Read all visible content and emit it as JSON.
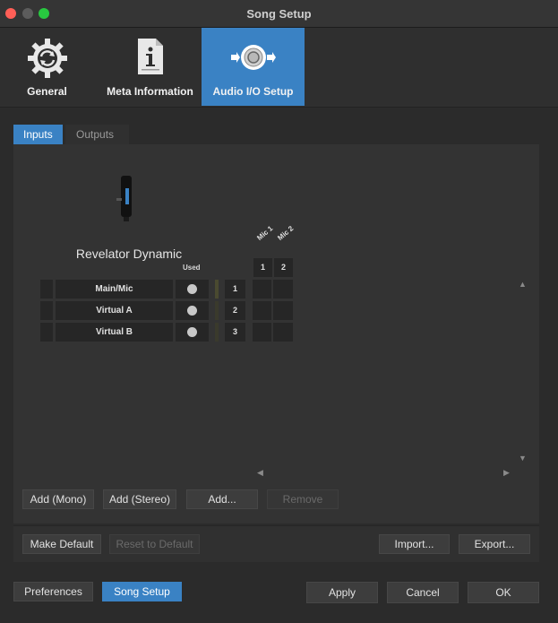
{
  "window": {
    "title": "Song Setup"
  },
  "nav": {
    "tabs": [
      {
        "label": "General",
        "icon": "gear-icon"
      },
      {
        "label": "Meta Information",
        "icon": "info-document-icon"
      },
      {
        "label": "Audio I/O Setup",
        "icon": "speaker-io-icon",
        "active": true
      }
    ]
  },
  "io_tabs": {
    "inputs": "Inputs",
    "outputs": "Outputs",
    "active": "Inputs"
  },
  "device": {
    "name": "Revelator Dynamic",
    "icon": "microphone-icon"
  },
  "grid": {
    "used_header": "Used",
    "column_headers": [
      "Mic 1",
      "Mic 2"
    ],
    "column_numbers": [
      "1",
      "2"
    ],
    "rows": [
      {
        "name": "Main/Mic",
        "number": "1"
      },
      {
        "name": "Virtual A",
        "number": "2"
      },
      {
        "name": "Virtual B",
        "number": "3"
      }
    ]
  },
  "channel_buttons": {
    "add_mono": "Add (Mono)",
    "add_stereo": "Add (Stereo)",
    "add": "Add...",
    "remove": "Remove"
  },
  "defaults": {
    "make_default": "Make Default",
    "reset_to_default": "Reset to Default",
    "import": "Import...",
    "export": "Export..."
  },
  "footer": {
    "preferences": "Preferences",
    "song_setup": "Song Setup",
    "apply": "Apply",
    "cancel": "Cancel",
    "ok": "OK"
  },
  "colors": {
    "accent": "#3a82c4",
    "background": "#2b2b2b"
  }
}
